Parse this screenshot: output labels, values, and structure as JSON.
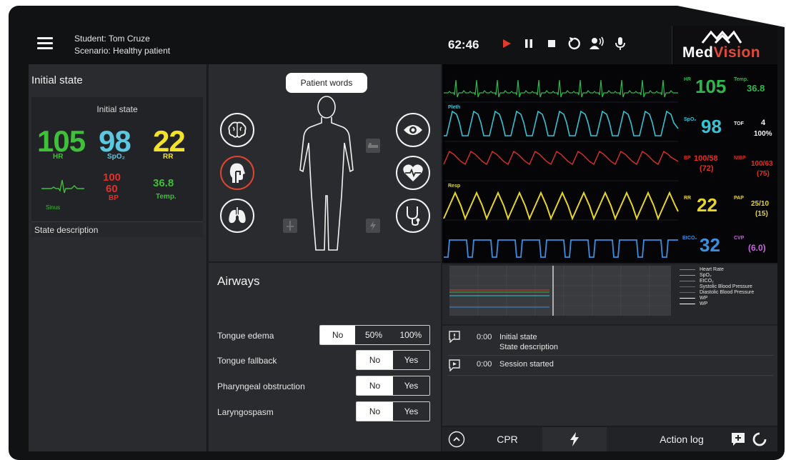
{
  "header": {
    "student": "Student:  Tom Cruze",
    "scenario": "Scenario:  Healthy patient",
    "timer": "62:46",
    "logo_med": "Med",
    "logo_vision": "Vision"
  },
  "left": {
    "title": "Initial state",
    "card_title": "Initial state",
    "hr_value": "105",
    "hr_label": "HR",
    "spo2_value": "98",
    "spo2_label": "SpO₂",
    "rr_value": "22",
    "rr_label": "RR",
    "rhythm_label": "Sinus",
    "bp_sys": "100",
    "bp_dia": "60",
    "bp_label": "BP",
    "temp_value": "36.8",
    "temp_label": "Temp.",
    "state_description": "State description"
  },
  "body": {
    "patient_words": "Patient words"
  },
  "airways": {
    "title": "Airways",
    "rows": [
      {
        "label": "Tongue edema",
        "options": [
          "No",
          "50%",
          "100%"
        ],
        "selected": "No"
      },
      {
        "label": "Tongue fallback",
        "options": [
          "No",
          "Yes"
        ],
        "selected": "Yes"
      },
      {
        "label": "Pharyngeal obstruction",
        "options": [
          "No",
          "Yes"
        ],
        "selected": "Yes"
      },
      {
        "label": "Laryngospasm",
        "options": [
          "No",
          "Yes"
        ],
        "selected": "Yes"
      }
    ]
  },
  "monitor": {
    "hr_label": "HR",
    "hr_value": "105",
    "temp_label": "Temp.",
    "temp_value": "36.8",
    "pleth_label": "Pleth",
    "spo2_label": "SpO₂",
    "spo2_value": "98",
    "tof_label": "TOF",
    "tof_value": "4",
    "tof_pct": "100%",
    "bp_label": "BP",
    "bp_value": "100/58",
    "bp_mean": "(72)",
    "nibp_label": "NIBP",
    "nibp_value": "100/63",
    "nibp_mean": "(75)",
    "resp_label": "Resp",
    "rr_label": "RR",
    "rr_value": "22",
    "pap_label": "PAP",
    "pap_value": "25/10",
    "pap_mean": "(15)",
    "etco2_label": "EtCO₂",
    "etco2_value": "32",
    "cvp_label": "CVP",
    "cvp_value": "(6.0)",
    "colors": {
      "hr": "#2db84d",
      "spo2": "#35c3d6",
      "bp": "#e0302a",
      "resp": "#e6d52a",
      "etco2": "#3a8fe0",
      "cvp": "#c46ad8"
    }
  },
  "trend": {
    "legend": [
      "Heart Rate",
      "SpO₂",
      "EtCO₂",
      "Systolic Blood Pressure",
      "Diastolic Blood Pressure",
      "WP",
      "WP"
    ]
  },
  "log": {
    "entries": [
      {
        "time": "0:00",
        "title": "Initial state",
        "subtitle": "State description"
      },
      {
        "time": "0:00",
        "title": "Session started",
        "subtitle": ""
      }
    ]
  },
  "bottombar": {
    "cpr": "CPR",
    "action_log": "Action log"
  }
}
